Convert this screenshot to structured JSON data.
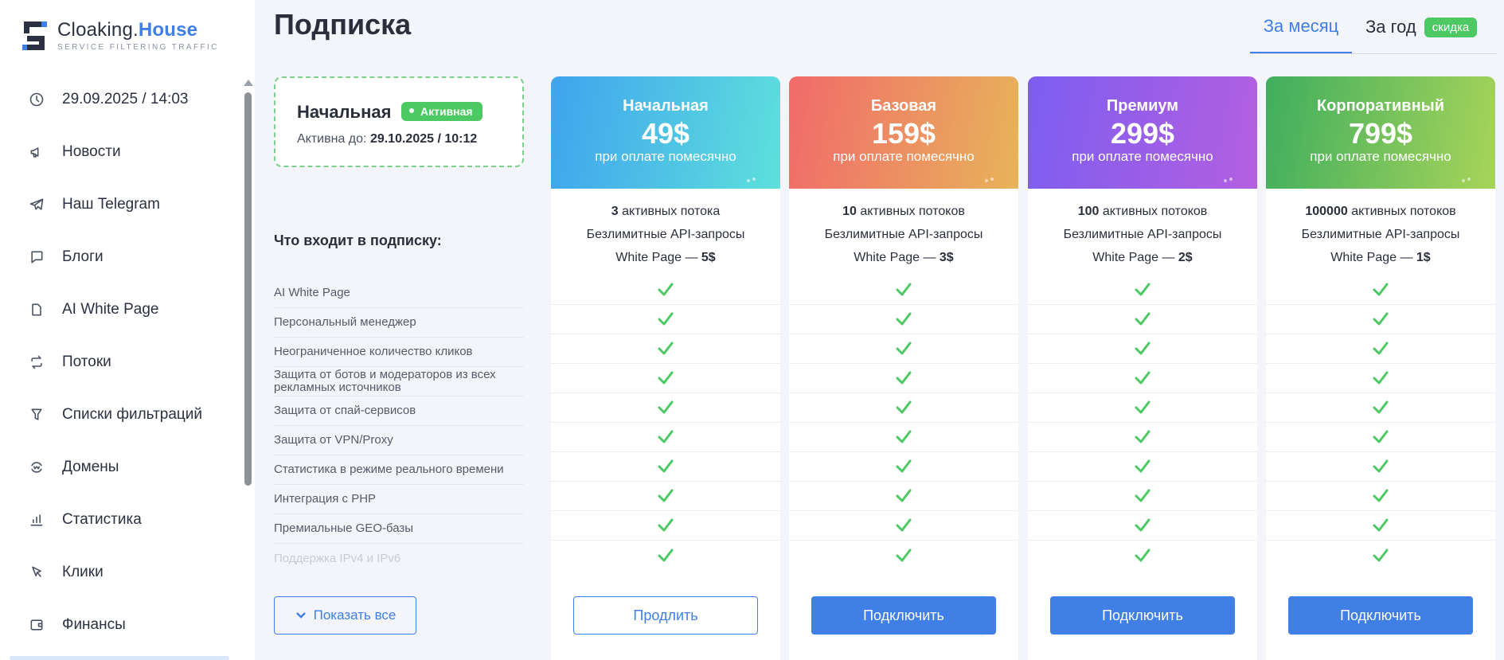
{
  "brand": {
    "name_part1": "Cloaking.",
    "name_part2": "House",
    "tagline": "SERVICE FILTERING TRAFFIC"
  },
  "sidebar": {
    "items": [
      {
        "label": "29.09.2025 / 14:03",
        "icon": "clock-icon"
      },
      {
        "label": "Новости",
        "icon": "megaphone-icon"
      },
      {
        "label": "Наш Telegram",
        "icon": "telegram-icon"
      },
      {
        "label": "Блоги",
        "icon": "chat-icon"
      },
      {
        "label": "AI White Page",
        "icon": "page-icon"
      },
      {
        "label": "Потоки",
        "icon": "flows-icon"
      },
      {
        "label": "Списки фильтраций",
        "icon": "filter-icon"
      },
      {
        "label": "Домены",
        "icon": "domain-icon"
      },
      {
        "label": "Статистика",
        "icon": "stats-icon"
      },
      {
        "label": "Клики",
        "icon": "cursor-icon"
      },
      {
        "label": "Финансы",
        "icon": "wallet-icon"
      }
    ]
  },
  "header": {
    "title": "Подписка",
    "tab_month": "За месяц",
    "tab_year": "За год",
    "discount_badge": "скидка"
  },
  "current_plan": {
    "name": "Начальная",
    "status": "Активная",
    "until_label": "Активна до:",
    "until_value": "29.10.2025 / 10:12"
  },
  "features": {
    "title": "Что входит в подписку:",
    "items": [
      "AI White Page",
      "Персональный менеджер",
      "Неограниченное количество кликов",
      "Защита от ботов и модераторов из всех рекламных источников",
      "Защита от спай-сервисов",
      "Защита от VPN/Proxy",
      "Статистика в режиме реального времени",
      "Интеграция с PHP",
      "Премиальные GEO-базы",
      "Поддержка IPv4 и IPv6"
    ],
    "show_all_label": "Показать все"
  },
  "plans": [
    {
      "name": "Начальная",
      "price": "49$",
      "period": "при оплате помесячно",
      "streams_count": "3",
      "streams_label": "активных потока",
      "api": "Безлимитные API-запросы",
      "wp_label": "White Page —",
      "wp_price": "5$",
      "button": "Продлить",
      "color_from": "#3fa3ee",
      "color_to": "#5ee0dc"
    },
    {
      "name": "Базовая",
      "price": "159$",
      "period": "при оплате помесячно",
      "streams_count": "10",
      "streams_label": "активных потоков",
      "api": "Безлимитные API-запросы",
      "wp_label": "White Page —",
      "wp_price": "3$",
      "button": "Подключить",
      "color_from": "#f16a6a",
      "color_to": "#e7b45a"
    },
    {
      "name": "Премиум",
      "price": "299$",
      "period": "при оплате помесячно",
      "streams_count": "100",
      "streams_label": "активных потоков",
      "api": "Безлимитные API-запросы",
      "wp_label": "White Page —",
      "wp_price": "2$",
      "button": "Подключить",
      "color_from": "#7c5ef0",
      "color_to": "#b45fe0"
    },
    {
      "name": "Корпоративный",
      "price": "799$",
      "period": "при оплате помесячно",
      "streams_count": "100000",
      "streams_label": "активных потоков",
      "api": "Безлимитные API-запросы",
      "wp_label": "White Page —",
      "wp_price": "1$",
      "button": "Подключить",
      "color_from": "#3fae5e",
      "color_to": "#a8d45a"
    }
  ],
  "colors": {
    "accent": "#3f7fe6",
    "success": "#4cc963"
  }
}
